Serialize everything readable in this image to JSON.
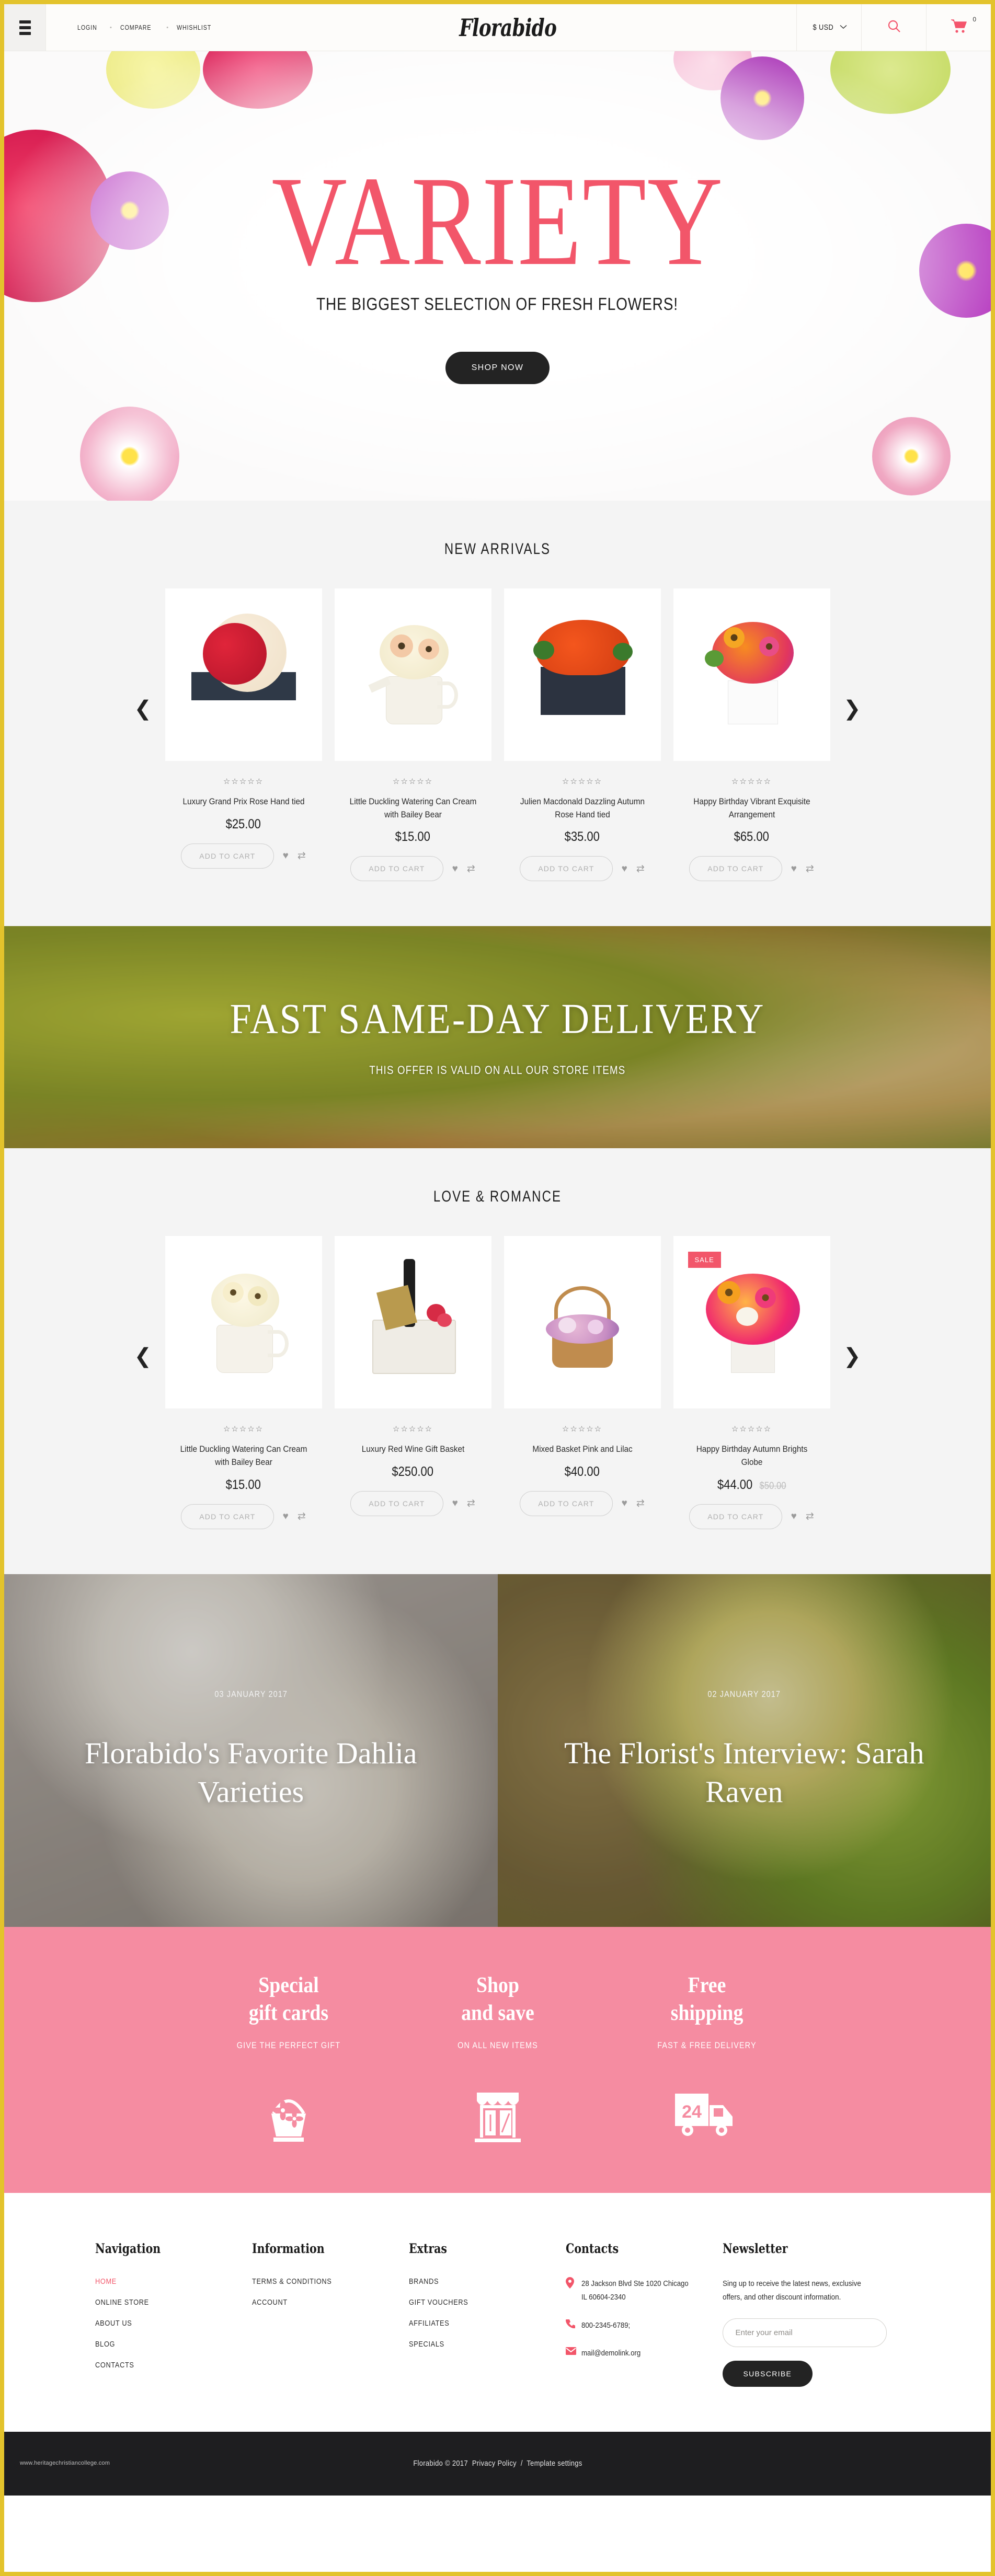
{
  "header": {
    "menu_icon": "hamburger-icon",
    "links": [
      {
        "label": "LOGIN"
      },
      {
        "label": "COMPARE"
      },
      {
        "label": "WHISHLIST"
      }
    ],
    "separator": "•",
    "logo": "Florabido",
    "currency": "$ USD",
    "caret": "⌄",
    "search_icon": "search-icon",
    "cart_icon": "cart-icon",
    "cart_count": "0"
  },
  "hero": {
    "title": "VARIETY",
    "subtitle": "THE BIGGEST SELECTION OF FRESH FLOWERS!",
    "cta": "SHOP NOW"
  },
  "new_arrivals": {
    "title": "NEW ARRIVALS",
    "prev_icon": "chevron-left-icon",
    "next_icon": "chevron-right-icon",
    "prev": "❮",
    "next": "❯",
    "stars": "☆☆☆☆☆",
    "add_to_cart": "ADD TO CART",
    "wishlist_icon": "heart-icon",
    "compare_icon": "compare-icon",
    "products": [
      {
        "name": "Luxury Grand Prix Rose Hand tied",
        "price": "$25.00",
        "old_price": "",
        "badge": ""
      },
      {
        "name": "Little Duckling Watering Can Cream with Bailey Bear",
        "price": "$15.00",
        "old_price": "",
        "badge": ""
      },
      {
        "name": "Julien Macdonald Dazzling Autumn Rose Hand tied",
        "price": "$35.00",
        "old_price": "",
        "badge": ""
      },
      {
        "name": "Happy Birthday Vibrant Exquisite Arrangement",
        "price": "$65.00",
        "old_price": "",
        "badge": ""
      }
    ]
  },
  "promo": {
    "title": "FAST SAME-DAY DELIVERY",
    "subtitle": "THIS OFFER IS VALID ON ALL OUR STORE ITEMS"
  },
  "love_romance": {
    "title": "LOVE & ROMANCE",
    "prev": "❮",
    "next": "❯",
    "stars": "☆☆☆☆☆",
    "add_to_cart": "ADD TO CART",
    "products": [
      {
        "name": "Little Duckling Watering Can Cream with Bailey Bear",
        "price": "$15.00",
        "old_price": "",
        "badge": ""
      },
      {
        "name": "Luxury Red Wine Gift Basket",
        "price": "$250.00",
        "old_price": "",
        "badge": ""
      },
      {
        "name": "Mixed Basket Pink and Lilac",
        "price": "$40.00",
        "old_price": "",
        "badge": ""
      },
      {
        "name": "Happy Birthday Autumn Brights Globe",
        "price": "$44.00",
        "old_price": "$50.00",
        "badge": "SALE"
      }
    ]
  },
  "blog": [
    {
      "date": "03 JANUARY 2017",
      "title": "Florabido's Favorite Dahlia Varieties"
    },
    {
      "date": "02 JANUARY 2017",
      "title": "The Florist's Interview: Sarah Raven"
    }
  ],
  "features": [
    {
      "title_line1": "Special",
      "title_line2": "gift cards",
      "subtitle": "GIVE THE PERFECT GIFT",
      "icon": "flower-basket-icon"
    },
    {
      "title_line1": "Shop",
      "title_line2": "and save",
      "subtitle": "ON ALL NEW ITEMS",
      "icon": "storefront-icon"
    },
    {
      "title_line1": "Free",
      "title_line2": "shipping",
      "subtitle": "FAST & FREE DELIVERY",
      "icon": "delivery-truck-24-icon"
    }
  ],
  "footer": {
    "navigation": {
      "heading": "Navigation",
      "items": [
        {
          "label": "HOME",
          "active": true
        },
        {
          "label": "ONLINE STORE",
          "active": false
        },
        {
          "label": "ABOUT US",
          "active": false
        },
        {
          "label": "BLOG",
          "active": false
        },
        {
          "label": "CONTACTS",
          "active": false
        }
      ]
    },
    "information": {
      "heading": "Information",
      "items": [
        {
          "label": "TERMS & CONDITIONS"
        },
        {
          "label": "ACCOUNT"
        }
      ]
    },
    "extras": {
      "heading": "Extras",
      "items": [
        {
          "label": "BRANDS"
        },
        {
          "label": "GIFT VOUCHERS"
        },
        {
          "label": "AFFILIATES"
        },
        {
          "label": "SPECIALS"
        }
      ]
    },
    "contacts": {
      "heading": "Contacts",
      "address": "28 Jackson Blvd Ste 1020 Chicago IL 60604-2340",
      "phone": "800-2345-6789;",
      "email": "mail@demolink.org",
      "location_icon": "map-pin-icon",
      "phone_icon": "phone-icon",
      "email_icon": "envelope-icon"
    },
    "newsletter": {
      "heading": "Newsletter",
      "text": "Sing up to receive the latest news, exclusive offers, and other discount information.",
      "placeholder": "Enter your email",
      "button": "SUBSCRIBE"
    }
  },
  "bottom": {
    "copyright": "Florabido © 2017",
    "privacy": "Privacy Policy",
    "sep": "/",
    "template": "Template settings",
    "watermark": "www.heritagechristiancollege.com"
  },
  "colors": {
    "accent_pink": "#f2566a",
    "feature_band": "#f58ca1",
    "border_yellow": "#e3c32c",
    "dark": "#232323"
  }
}
